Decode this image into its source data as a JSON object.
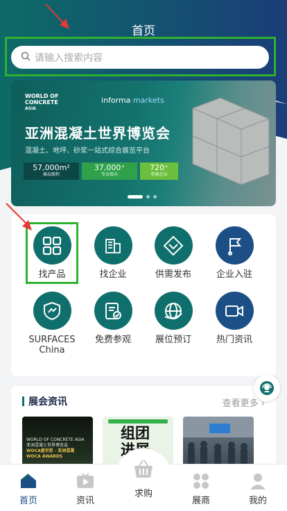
{
  "page": {
    "title": "首页"
  },
  "search": {
    "placeholder": "请输入搜索内容"
  },
  "banner": {
    "logo_line1": "WORLD OF",
    "logo_line2": "CONCRETE",
    "logo_line3": "ASIA",
    "partner": "informa",
    "partner_suffix": "markets",
    "title": "亚洲混凝土世界博览会",
    "subtitle": "混凝土、地坪、砂浆一站式综合展览平台",
    "stats": [
      {
        "value": "57,000m²",
        "label": "展出面积"
      },
      {
        "value": "37,000⁺",
        "label": "专业观众"
      },
      {
        "value": "720⁺",
        "label": "参展企业"
      }
    ]
  },
  "menu": {
    "items": [
      {
        "label": "找产品",
        "icon": "grid-icon"
      },
      {
        "label": "找企业",
        "icon": "building-icon"
      },
      {
        "label": "供需发布",
        "icon": "diamond-icon"
      },
      {
        "label": "企业入驻",
        "icon": "flag-icon"
      },
      {
        "label": "SURFACES China",
        "label_line1": "SURFACES",
        "label_line2": "China",
        "icon": "shield-icon"
      },
      {
        "label": "免费参观",
        "icon": "ticket-icon"
      },
      {
        "label": "展位预订",
        "icon": "globe-icon"
      },
      {
        "label": "热门资讯",
        "icon": "video-icon"
      }
    ]
  },
  "news": {
    "title": "展会资讯",
    "more": "查看更多",
    "thumb1_line1": "WORLD OF CONCRETE ASIA",
    "thumb1_line2": "亚洲混凝土世界博览会",
    "thumb1_line3": "WOCA盛世奖 · 亚洲混凝",
    "thumb1_line4": "WOCA AWARDS",
    "thumb2_text": "组团进展"
  },
  "tabbar": {
    "items": [
      {
        "label": "首页",
        "active": true
      },
      {
        "label": "资讯",
        "active": false
      },
      {
        "label": "求购",
        "active": false
      },
      {
        "label": "展商",
        "active": false
      },
      {
        "label": "我的",
        "active": false
      }
    ]
  },
  "colors": {
    "teal": "#0f6f6c",
    "navy": "#1b4f86",
    "highlight_green": "#2fb130",
    "arrow_red": "#e53935"
  }
}
